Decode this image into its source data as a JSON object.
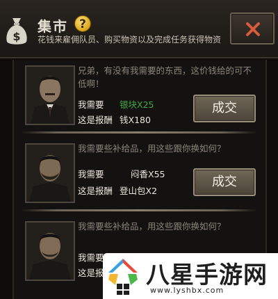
{
  "header": {
    "title": "集市",
    "help_symbol": "?",
    "subtitle": "花钱来雇佣队员、购买物资以及完成任务获得物资",
    "close_icon": "close-icon"
  },
  "quests": [
    {
      "dialogue": "兄弟，有没有我需要的东西，这价钱给的可不低啊！",
      "need_label": "我需要",
      "need_value": "银块X25",
      "need_color": "#3faa3f",
      "reward_label": "这是报酬",
      "reward_value": "钱X180",
      "button_label": "成交"
    },
    {
      "dialogue": "我需要些补给品，用这些跟你换如何？",
      "need_label": "我需要",
      "need_value": "闷香X55",
      "need_color": "#ece6da",
      "reward_label": "这是报酬",
      "reward_value": "登山包X2",
      "button_label": "成交"
    },
    {
      "dialogue": "我需要些补给品，用这些跟你换如何？",
      "need_label": "我需要",
      "need_value": "",
      "need_color": "#ece6da",
      "reward_label": "这是报",
      "reward_value": "",
      "button_label": ""
    }
  ],
  "watermark": {
    "brand": "八星手游网",
    "url": "www.lyshbx.com"
  }
}
